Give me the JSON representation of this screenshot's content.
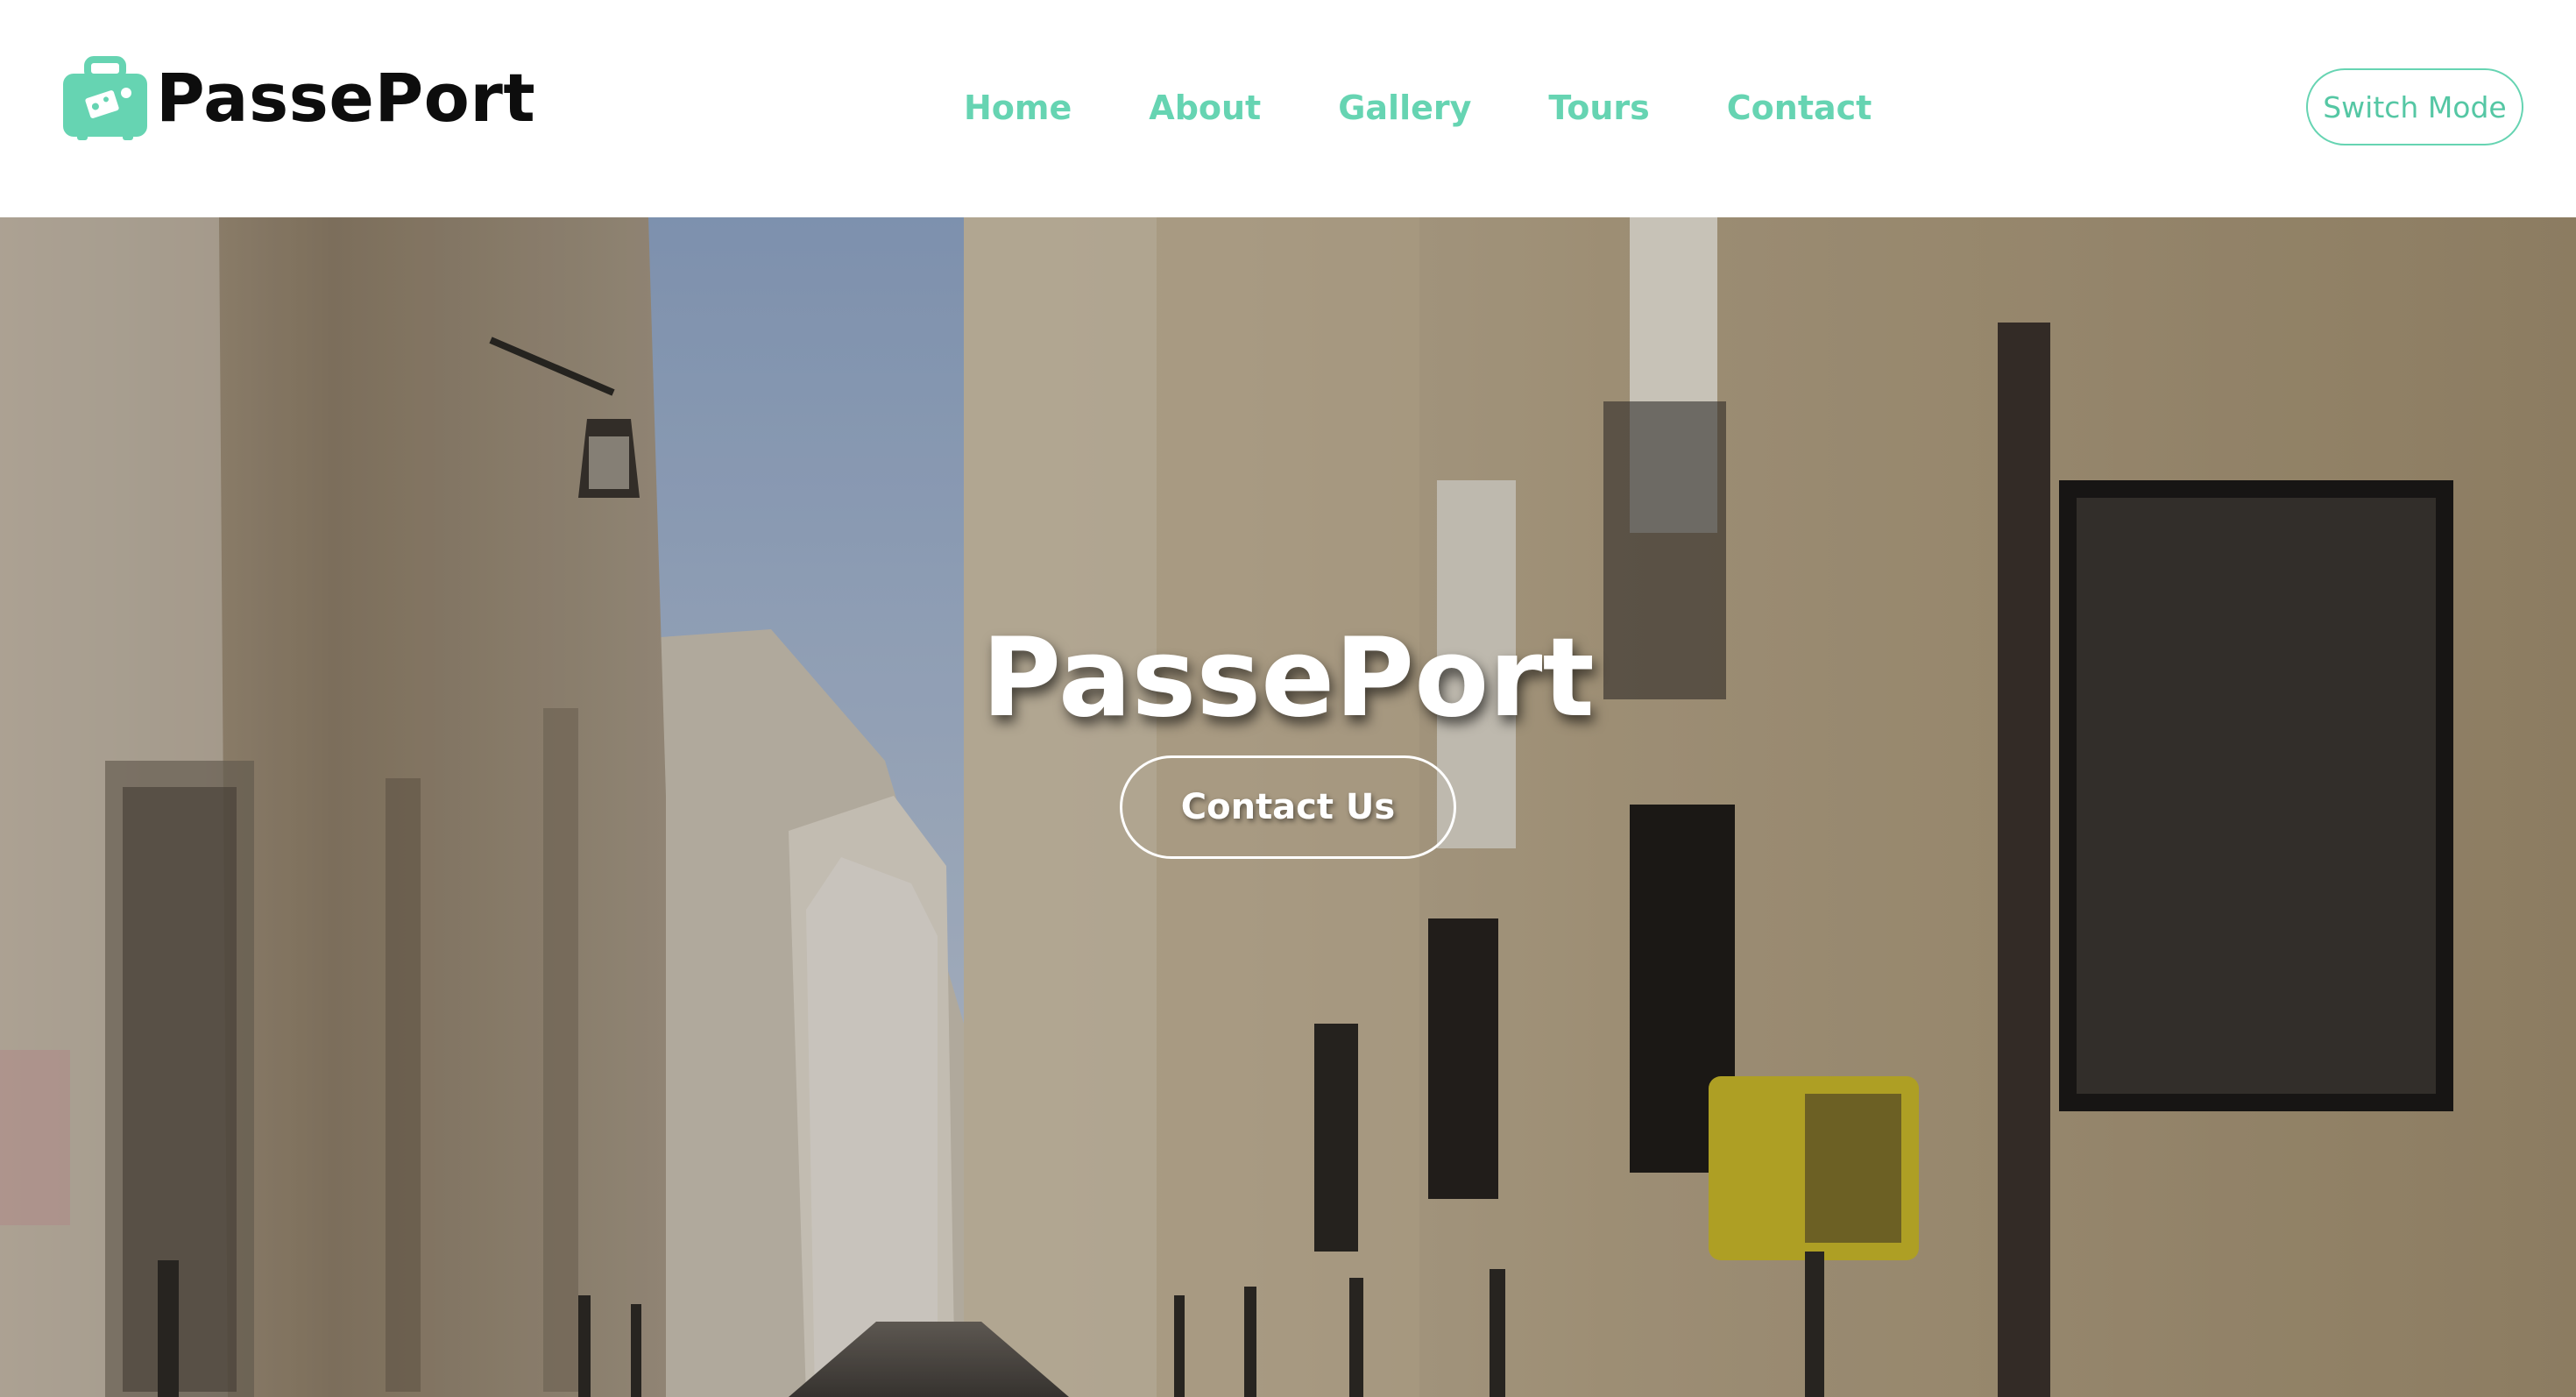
{
  "brand": {
    "name": "PassePort",
    "logo_icon": "suitcase-icon",
    "accent_color": "#66d4b2"
  },
  "nav": {
    "items": [
      {
        "label": "Home"
      },
      {
        "label": "About"
      },
      {
        "label": "Gallery"
      },
      {
        "label": "Tours"
      },
      {
        "label": "Contact"
      }
    ]
  },
  "header": {
    "switch_mode_label": "Switch Mode"
  },
  "hero": {
    "title": "PassePort",
    "cta_label": "Contact Us",
    "background": "paris-street-photo"
  }
}
